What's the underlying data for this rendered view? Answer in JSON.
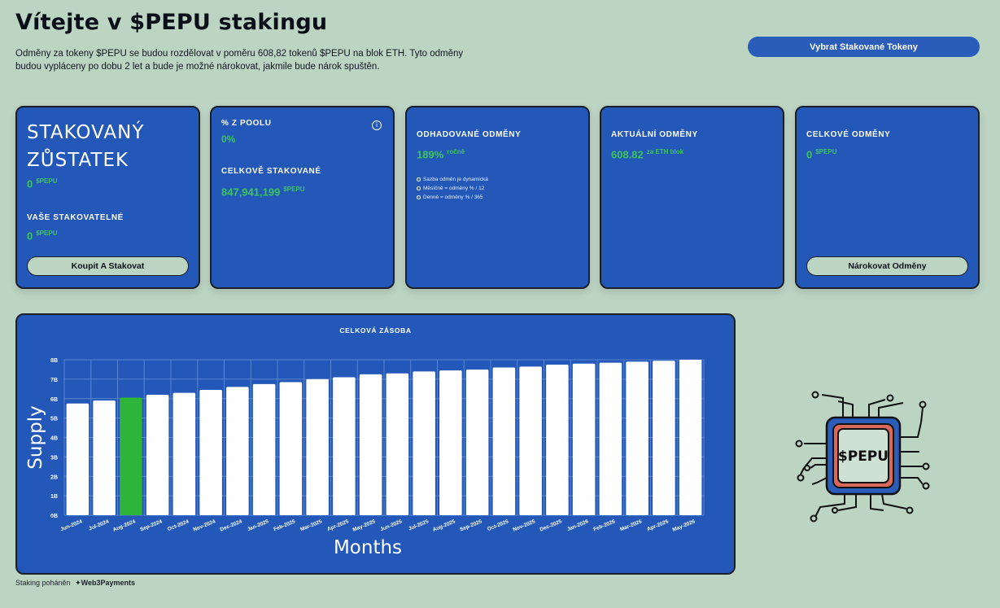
{
  "header": {
    "title": "Vítejte v $PEPU stakingu",
    "description": "Odměny za tokeny $PEPU se budou rozdělovat v poměru 608,82 tokenů $PEPU na blok ETH. Tyto odměny budou vypláceny po dobu 2 let a bude je možné nárokovat, jakmile bude nárok spuštěn.",
    "withdraw_button": "Vybrat Stakované Tokeny"
  },
  "cards": {
    "staked": {
      "title_line1": "Stakovaný",
      "title_line2": "Zůstatek",
      "value": "0",
      "unit": "$PEPU",
      "stakeable_label": "Vaše stakovatelné",
      "stakeable_value": "0",
      "stakeable_unit": "$PEPU",
      "button": "Koupit A Stakovat"
    },
    "pool": {
      "label": "% z poolu",
      "value": "0%",
      "info_icon": "i",
      "total_label": "Celkově stakované",
      "total_value": "847,941,199",
      "total_unit": "$PEPU"
    },
    "estimated": {
      "label": "Odhadované odměny",
      "value": "189%",
      "value_suffix": "ročně",
      "notes": [
        "Sazba odměn je dynamická",
        "Měsíčně = odměny % / 12",
        "Denně = odměny % / 365"
      ]
    },
    "current": {
      "label": "Aktuální odměny",
      "value": "608.82",
      "value_suffix": "za ETH blok"
    },
    "total": {
      "label": "Celkové odměny",
      "value": "0",
      "unit": "$PEPU",
      "button": "Nárokovat Odměny"
    }
  },
  "chart_data": {
    "type": "bar",
    "title": "CELKOVÁ ZÁSOBA",
    "xlabel": "Months",
    "ylabel": "Supply",
    "yticks": [
      "0B",
      "1B",
      "2B",
      "3B",
      "4B",
      "5B",
      "6B",
      "7B",
      "8B"
    ],
    "ylim": [
      0,
      8
    ],
    "grid": true,
    "highlight_index": 2,
    "colors": {
      "bar": "#ffffff",
      "highlight": "#2fb43a",
      "grid": "#5a84d0"
    },
    "categories": [
      "Jun-2024",
      "Jul-2024",
      "Aug-2024",
      "Sep-2024",
      "Oct-2024",
      "Nov-2024",
      "Dec-2024",
      "Jan-2025",
      "Feb-2025",
      "Mar-2025",
      "Apr-2025",
      "May-2025",
      "Jun-2025",
      "Jul-2025",
      "Aug-2025",
      "Sep-2025",
      "Oct-2025",
      "Nov-2025",
      "Dec-2025",
      "Jan-2026",
      "Feb-2026",
      "Mar-2026",
      "Apr-2026",
      "May-2026"
    ],
    "values": [
      5.75,
      5.9,
      6.05,
      6.2,
      6.3,
      6.45,
      6.6,
      6.75,
      6.85,
      7.0,
      7.1,
      7.25,
      7.3,
      7.4,
      7.45,
      7.5,
      7.6,
      7.65,
      7.75,
      7.8,
      7.85,
      7.9,
      7.95,
      8.0
    ]
  },
  "logo": {
    "text": "$PEPU",
    "icon": "chip-logo-icon"
  },
  "footer": {
    "prefix": "Staking poháněn",
    "brand": "Web3Payments"
  }
}
